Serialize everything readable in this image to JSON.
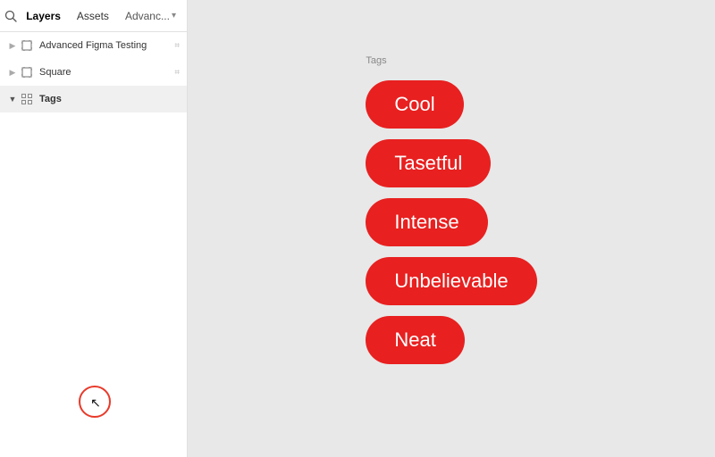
{
  "sidebar": {
    "header": {
      "tabs": [
        {
          "id": "layers",
          "label": "Layers",
          "active": true
        },
        {
          "id": "assets",
          "label": "Assets",
          "active": false
        },
        {
          "id": "advance",
          "label": "Advanc...",
          "active": false
        }
      ]
    },
    "items": [
      {
        "id": "advanced-figma-testing",
        "name": "Advanced Figma Testing",
        "type": "frame",
        "indent": 0,
        "meta": "⌗"
      },
      {
        "id": "square",
        "name": "Square",
        "type": "frame",
        "indent": 0,
        "meta": "⌗"
      },
      {
        "id": "tags",
        "name": "Tags",
        "type": "group",
        "indent": 0,
        "meta": ""
      }
    ]
  },
  "canvas": {
    "tags_label": "Tags",
    "tags": [
      {
        "id": "cool",
        "label": "Cool"
      },
      {
        "id": "tasetful",
        "label": "Tasetful"
      },
      {
        "id": "intense",
        "label": "Intense"
      },
      {
        "id": "unbelievable",
        "label": "Unbelievable"
      },
      {
        "id": "neat",
        "label": "Neat"
      }
    ]
  },
  "icons": {
    "search": "🔍",
    "cursor": "↖"
  }
}
